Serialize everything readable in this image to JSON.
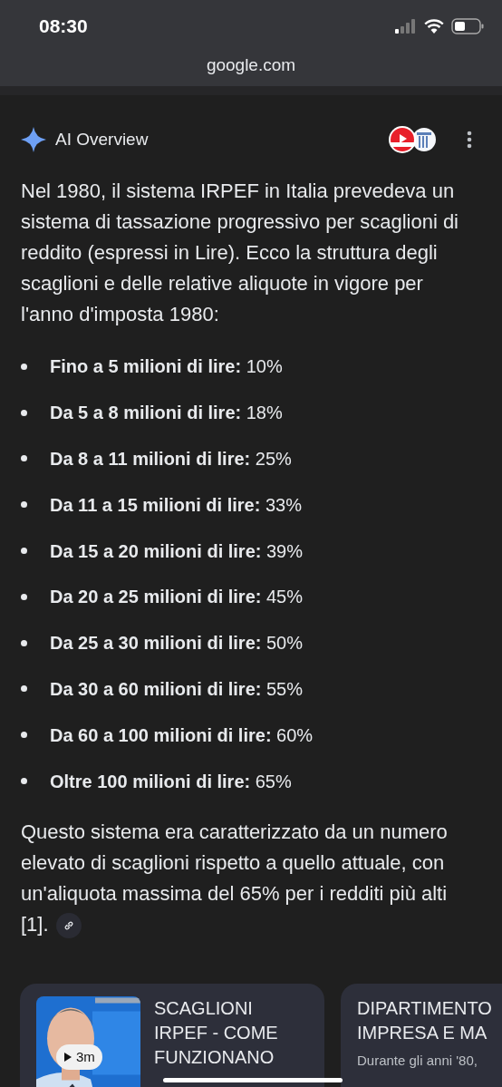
{
  "status_bar": {
    "time": "08:30"
  },
  "address_bar": {
    "url": "google.com"
  },
  "overview": {
    "title": "AI Overview",
    "intro": "Nel 1980, il sistema IRPEF in Italia prevedeva un sistema di tassazione progressivo per scaglioni di reddito (espressi in Lire). Ecco la struttura degli scaglioni e delle relative aliquote in vigore per l'anno d'imposta 1980:",
    "brackets": [
      "**Fino a 5 milioni di lire:** 10%",
      "**Da 5 a 8 milioni di lire:** 18%",
      "**Da 8 a 11 milioni di lire:** 25%",
      "**Da 11 a 15 milioni di lire:** 33%",
      "**Da 15 a 20 milioni di lire:** 39%",
      "**Da 20 a 25 milioni di lire:** 45%",
      "**Da 25 a 30 milioni di lire:** 50%",
      "**Da 30 a 60 milioni di lire:** 55%",
      "**Da 60 a 100 milioni di lire:** 60%",
      "**Oltre 100 milioni di lire:** 65%"
    ],
    "summary": "Questo sistema era caratterizzato da un numero elevato di scaglioni rispetto a quello attuale, con un'aliquota massima del 65% per i redditi più alti [1]."
  },
  "sources": [
    {
      "kind": "video",
      "title": "SCAGLIONI IRPEF - COME FUNZIONANO",
      "duration": "3m"
    },
    {
      "kind": "article",
      "title": "DIPARTIMENTO IMPRESA E MA",
      "snippet": "Durante gli anni '80,"
    }
  ]
}
